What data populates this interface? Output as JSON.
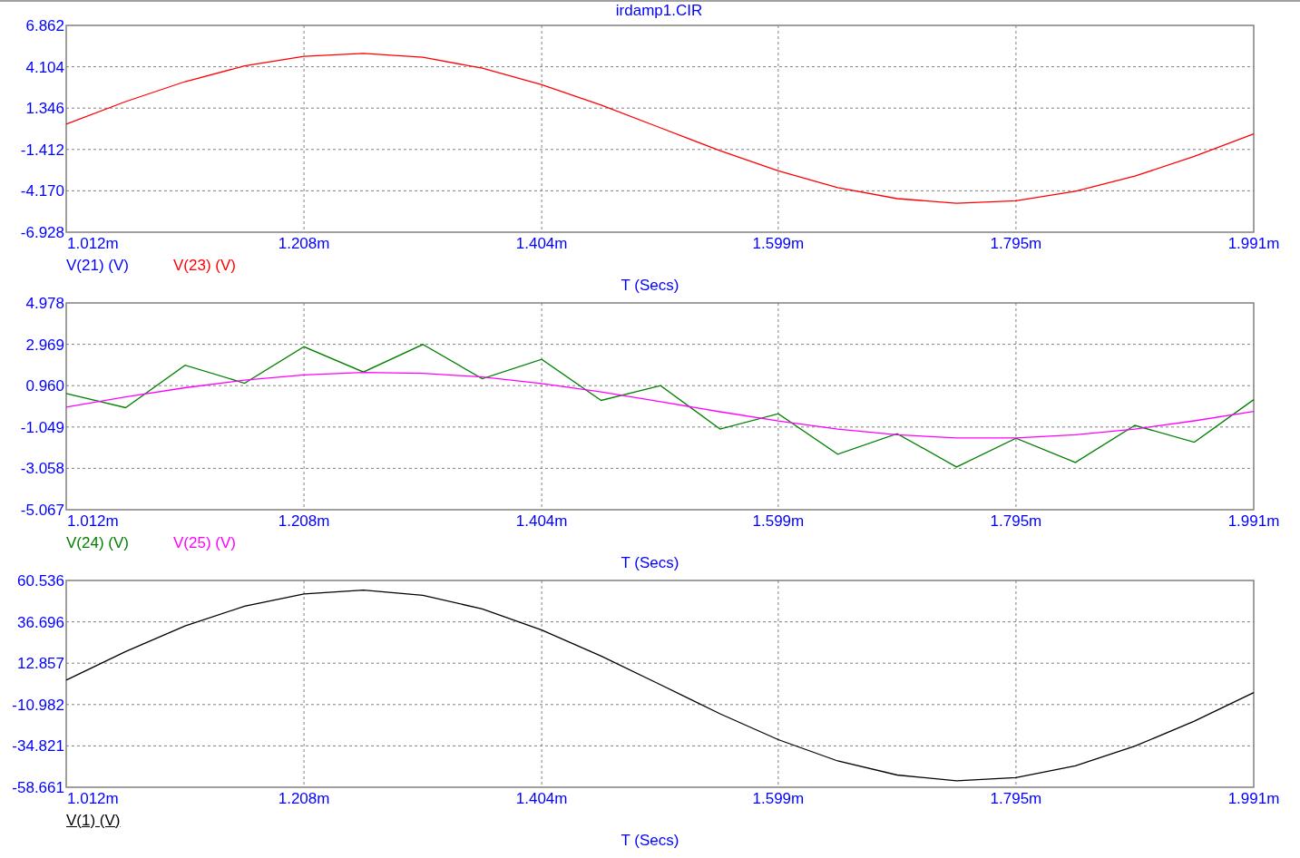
{
  "window": {
    "title": "irdamp1.CIR"
  },
  "plots": [
    {
      "chart_data": {
        "type": "line",
        "grid": true,
        "xlabel": "T (Secs)",
        "xlim": [
          1.012,
          1.991
        ],
        "ylim": [
          -6.928,
          6.862
        ],
        "xticks": [
          {
            "value": 1.012,
            "label": "1.012m"
          },
          {
            "value": 1.208,
            "label": "1.208m"
          },
          {
            "value": 1.404,
            "label": "1.404m"
          },
          {
            "value": 1.599,
            "label": "1.599m"
          },
          {
            "value": 1.795,
            "label": "1.795m"
          },
          {
            "value": 1.991,
            "label": "1.991m"
          }
        ],
        "yticks": [
          {
            "value": 6.862,
            "label": "6.862"
          },
          {
            "value": 4.104,
            "label": "4.104"
          },
          {
            "value": 1.346,
            "label": "1.346"
          },
          {
            "value": -1.412,
            "label": "-1.412"
          },
          {
            "value": -4.17,
            "label": "-4.170"
          },
          {
            "value": -6.928,
            "label": "-6.928"
          }
        ],
        "x": [
          1.012,
          1.061,
          1.11,
          1.159,
          1.208,
          1.257,
          1.306,
          1.355,
          1.404,
          1.453,
          1.502,
          1.551,
          1.599,
          1.648,
          1.697,
          1.746,
          1.795,
          1.844,
          1.893,
          1.942,
          1.991
        ],
        "series": [
          {
            "color": "#ff0000",
            "values": [
              0.28,
              1.78,
              3.11,
              4.16,
              4.8,
              5.0,
              4.73,
              4.01,
              2.91,
              1.55,
              0.03,
              -1.49,
              -2.84,
              -3.95,
              -4.69,
              -5.0,
              -4.83,
              -4.2,
              -3.19,
              -1.87,
              -0.37
            ]
          }
        ]
      },
      "legend": [
        {
          "label": "V(21) (V)",
          "color": "#0000ff",
          "selected": false
        },
        {
          "label": "V(23) (V)",
          "color": "#ff0000",
          "selected": false
        }
      ]
    },
    {
      "chart_data": {
        "type": "line",
        "grid": true,
        "xlabel": "T (Secs)",
        "xlim": [
          1.012,
          1.991
        ],
        "ylim": [
          -5.067,
          4.978
        ],
        "xticks": [
          {
            "value": 1.012,
            "label": "1.012m"
          },
          {
            "value": 1.208,
            "label": "1.208m"
          },
          {
            "value": 1.404,
            "label": "1.404m"
          },
          {
            "value": 1.599,
            "label": "1.599m"
          },
          {
            "value": 1.795,
            "label": "1.795m"
          },
          {
            "value": 1.991,
            "label": "1.991m"
          }
        ],
        "yticks": [
          {
            "value": 4.978,
            "label": "4.978"
          },
          {
            "value": 2.969,
            "label": "2.969"
          },
          {
            "value": 0.96,
            "label": "0.960"
          },
          {
            "value": -1.049,
            "label": "-1.049"
          },
          {
            "value": -3.058,
            "label": "-3.058"
          },
          {
            "value": -5.067,
            "label": "-5.067"
          }
        ],
        "x": [
          1.012,
          1.061,
          1.11,
          1.159,
          1.208,
          1.257,
          1.306,
          1.355,
          1.404,
          1.453,
          1.502,
          1.551,
          1.599,
          1.648,
          1.697,
          1.746,
          1.795,
          1.844,
          1.893,
          1.942,
          1.991
        ],
        "series": [
          {
            "color": "#008000",
            "values": [
              0.58,
              -0.11,
              1.95,
              1.08,
              2.85,
              1.62,
              2.96,
              1.3,
              2.24,
              0.24,
              0.96,
              -1.15,
              -0.4,
              -2.37,
              -1.37,
              -2.99,
              -1.59,
              -2.77,
              -0.97,
              -1.79,
              0.28
            ]
          },
          {
            "color": "#ff00ff",
            "values": [
              -0.08,
              0.41,
              0.86,
              1.23,
              1.48,
              1.6,
              1.56,
              1.38,
              1.06,
              0.65,
              0.18,
              -0.31,
              -0.76,
              -1.15,
              -1.43,
              -1.58,
              -1.58,
              -1.43,
              -1.15,
              -0.75,
              -0.29
            ]
          }
        ]
      },
      "legend": [
        {
          "label": "V(24) (V)",
          "color": "#008000",
          "selected": false
        },
        {
          "label": "V(25) (V)",
          "color": "#ff00ff",
          "selected": false
        }
      ]
    },
    {
      "chart_data": {
        "type": "line",
        "grid": true,
        "xlabel": "T (Secs)",
        "xlim": [
          1.012,
          1.991
        ],
        "ylim": [
          -58.661,
          60.536
        ],
        "xticks": [
          {
            "value": 1.012,
            "label": "1.012m"
          },
          {
            "value": 1.208,
            "label": "1.208m"
          },
          {
            "value": 1.404,
            "label": "1.404m"
          },
          {
            "value": 1.599,
            "label": "1.599m"
          },
          {
            "value": 1.795,
            "label": "1.795m"
          },
          {
            "value": 1.991,
            "label": "1.991m"
          }
        ],
        "yticks": [
          {
            "value": 60.536,
            "label": "60.536"
          },
          {
            "value": 36.696,
            "label": "36.696"
          },
          {
            "value": 12.857,
            "label": "12.857"
          },
          {
            "value": -10.982,
            "label": "-10.982"
          },
          {
            "value": -34.821,
            "label": "-34.821"
          },
          {
            "value": -58.661,
            "label": "-58.661"
          }
        ],
        "x": [
          1.012,
          1.061,
          1.11,
          1.159,
          1.208,
          1.257,
          1.306,
          1.355,
          1.404,
          1.453,
          1.502,
          1.551,
          1.599,
          1.648,
          1.697,
          1.746,
          1.795,
          1.844,
          1.893,
          1.942,
          1.991
        ],
        "series": [
          {
            "color": "#000000",
            "values": [
              3.1,
              19.6,
              34.3,
              45.7,
              52.8,
              55.0,
              52.0,
              44.1,
              32.0,
              17.0,
              0.4,
              -16.3,
              -31.2,
              -43.5,
              -51.6,
              -54.9,
              -53.1,
              -46.3,
              -35.0,
              -20.6,
              -4.1
            ]
          }
        ]
      },
      "legend": [
        {
          "label": "V(1) (V)",
          "color": "#000000",
          "selected": true
        }
      ]
    }
  ]
}
